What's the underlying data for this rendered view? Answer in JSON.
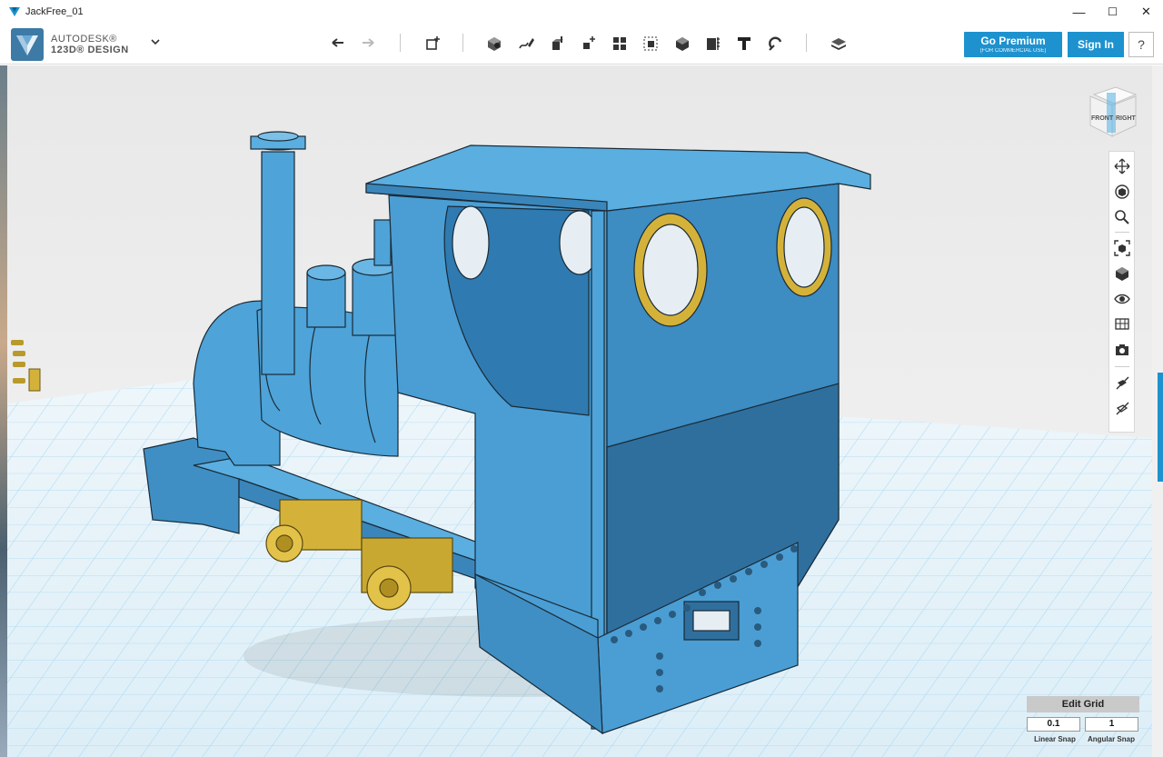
{
  "window": {
    "title": "JackFree_01",
    "minimize": "—",
    "maximize": "☐",
    "close": "✕"
  },
  "app": {
    "brand_line1": "AUTODESK®",
    "brand_line2": "123D® DESIGN"
  },
  "toolbar": {
    "tools": [
      "undo-icon",
      "redo-icon",
      "transform-icon",
      "primitives-icon",
      "sketch-icon",
      "construct-icon",
      "modify-icon",
      "pattern-icon",
      "group-icon",
      "combine-icon",
      "measure-icon",
      "text-icon",
      "snap-icon",
      "material-icon"
    ],
    "premium_label": "Go Premium",
    "premium_sub": "(FOR COMMERCIAL USE)",
    "signin_label": "Sign In",
    "help_label": "?"
  },
  "viewcube": {
    "front_label": "FRONT",
    "right_label": "RIGHT"
  },
  "navbar": {
    "buttons": [
      "pan-icon",
      "orbit-icon",
      "zoom-icon",
      "fit-icon",
      "views-icon",
      "visibility-icon",
      "materials-outlines-icon",
      "screenshot-icon",
      "hide-icon",
      "unhide-icon"
    ]
  },
  "grid": {
    "edit_label": "Edit Grid",
    "linear_snap_value": "0.1",
    "angular_snap_value": "1",
    "linear_snap_label": "Linear Snap",
    "angular_snap_label": "Angular Snap"
  },
  "colors": {
    "accent": "#1d92cf",
    "model_blue": "#4ea3d8",
    "model_gold": "#d4b23a",
    "grid_line": "#7cc6ec"
  }
}
